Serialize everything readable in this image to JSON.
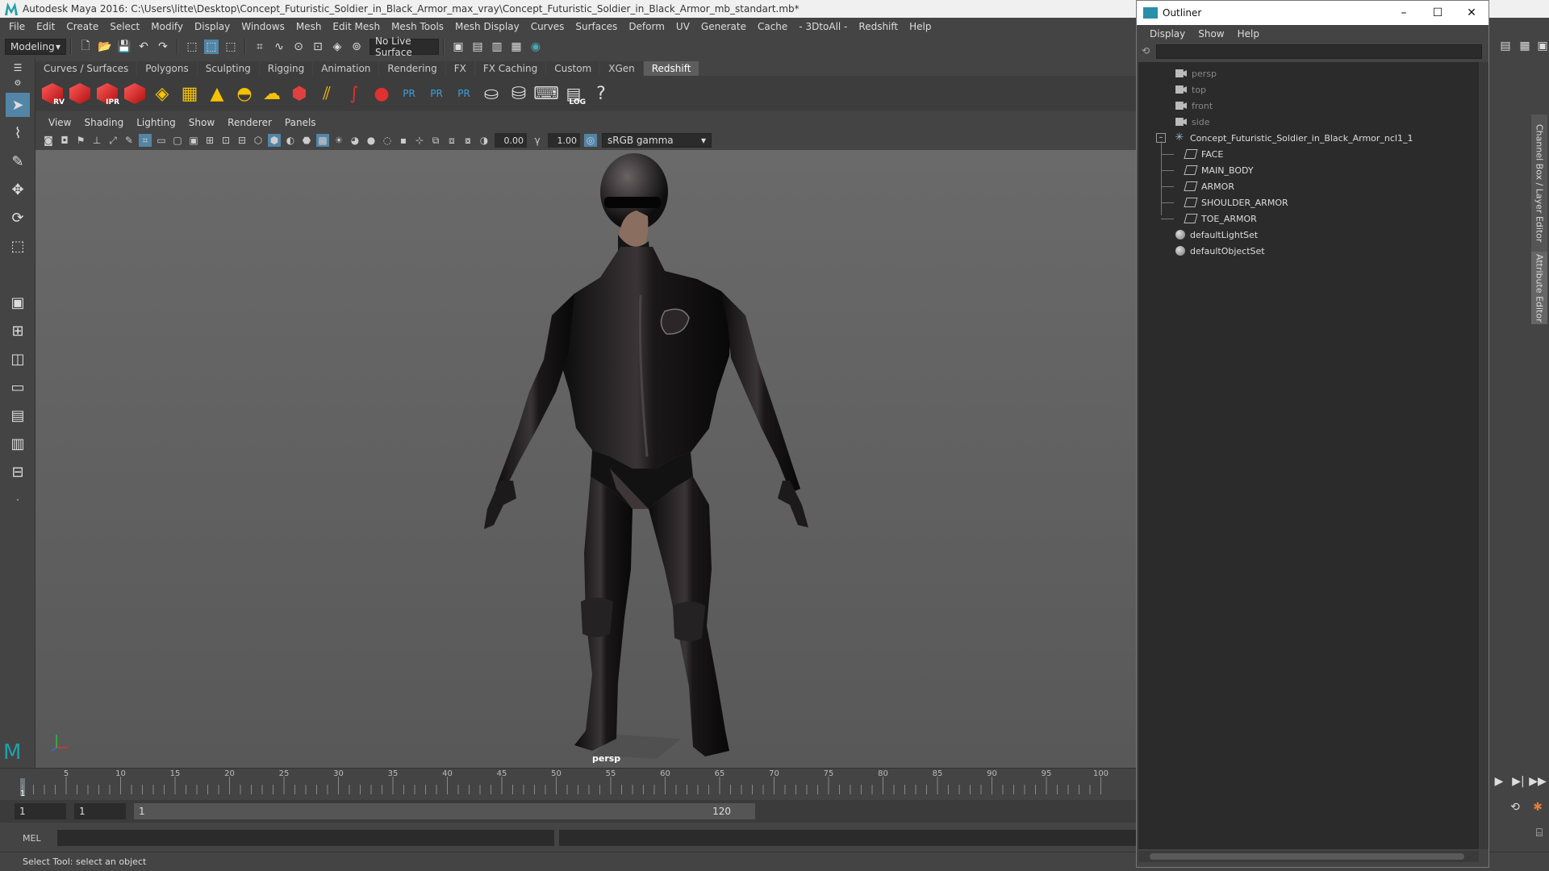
{
  "window": {
    "title": "Autodesk Maya 2016: C:\\Users\\litte\\Desktop\\Concept_Futuristic_Soldier_in_Black_Armor_max_vray\\Concept_Futuristic_Soldier_in_Black_Armor_mb_standart.mb*"
  },
  "menubar": [
    "File",
    "Edit",
    "Create",
    "Select",
    "Modify",
    "Display",
    "Windows",
    "Mesh",
    "Edit Mesh",
    "Mesh Tools",
    "Mesh Display",
    "Curves",
    "Surfaces",
    "Deform",
    "UV",
    "Generate",
    "Cache",
    "- 3DtoAll -",
    "Redshift",
    "Help"
  ],
  "statusline": {
    "mode": "Modeling",
    "live_surface": "No Live Surface"
  },
  "shelf": {
    "tabs": [
      "Curves / Surfaces",
      "Polygons",
      "Sculpting",
      "Rigging",
      "Animation",
      "Rendering",
      "FX",
      "FX Caching",
      "Custom",
      "XGen",
      "Redshift"
    ],
    "active_tab": "Redshift",
    "icon_labels": {
      "rv": "RV",
      "ipr": "IPR",
      "pr": "PR",
      "log": "LOG"
    }
  },
  "viewport": {
    "menu": [
      "View",
      "Shading",
      "Lighting",
      "Show",
      "Renderer",
      "Panels"
    ],
    "exposure": "0.00",
    "gamma": "1.00",
    "colorspace": "sRGB gamma",
    "camera_label": "persp"
  },
  "timeslider": {
    "ticks": [
      "5",
      "10",
      "15",
      "20",
      "25",
      "30",
      "35",
      "40",
      "45",
      "50",
      "55",
      "60",
      "65",
      "70",
      "75",
      "80",
      "85",
      "90",
      "95",
      "100"
    ],
    "current_frame": "1"
  },
  "range": {
    "start": "1",
    "playback_start": "1",
    "range_start_label": "1",
    "range_end_label": "120"
  },
  "cmdline": {
    "lang": "MEL"
  },
  "helpline": "Select Tool: select an object",
  "outliner": {
    "title": "Outliner",
    "menu": [
      "Display",
      "Show",
      "Help"
    ],
    "items": [
      {
        "label": "persp",
        "type": "camera"
      },
      {
        "label": "top",
        "type": "camera"
      },
      {
        "label": "front",
        "type": "camera"
      },
      {
        "label": "side",
        "type": "camera"
      },
      {
        "label": "Concept_Futuristic_Soldier_in_Black_Armor_ncl1_1",
        "type": "group"
      },
      {
        "label": "FACE",
        "type": "mesh"
      },
      {
        "label": "MAIN_BODY",
        "type": "mesh"
      },
      {
        "label": "ARMOR",
        "type": "mesh"
      },
      {
        "label": "SHOULDER_ARMOR",
        "type": "mesh"
      },
      {
        "label": "TOE_ARMOR",
        "type": "mesh"
      },
      {
        "label": "defaultLightSet",
        "type": "set"
      },
      {
        "label": "defaultObjectSet",
        "type": "set"
      }
    ]
  },
  "rightstrip": {
    "tab1": "Channel Box / Layer Editor",
    "tab2": "Attribute Editor"
  },
  "colors": {
    "accent": "#5285a6",
    "bg": "#444444",
    "redshift_red": "#e03030"
  }
}
